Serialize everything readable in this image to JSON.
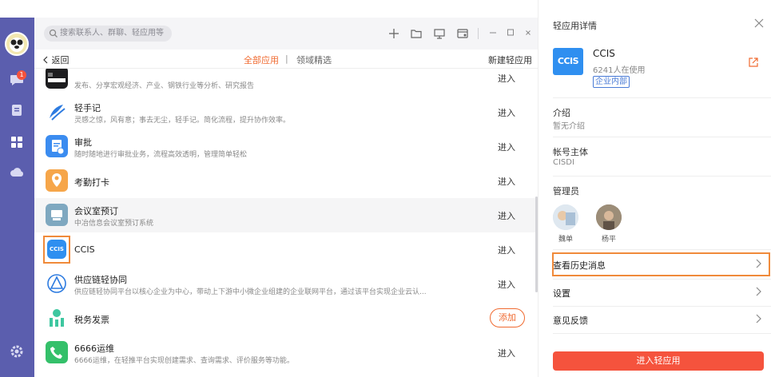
{
  "search": {
    "placeholder": "搜索联系人、群聊、轻应用等"
  },
  "nav": {
    "back": "返回",
    "tab_all": "全部应用",
    "tab_sep": "|",
    "tab_field": "领域精选",
    "new_app": "新建轻应用",
    "chat_badge": "1"
  },
  "apps": [
    {
      "name": "",
      "desc": "发布、分享宏观经济、产业、钢铁行业等分析、研究报告",
      "action": "进入"
    },
    {
      "name": "轻手记",
      "desc": "灵感之惊，风有意；事去无尘，轻手记。简化流程，提升协作效率。",
      "action": "进入"
    },
    {
      "name": "审批",
      "desc": "随时随地进行审批业务，流程高效透明，管理简单轻松",
      "action": "进入"
    },
    {
      "name": "考勤打卡",
      "desc": "",
      "action": "进入"
    },
    {
      "name": "会议室预订",
      "desc": "中冶信息会议室预订系统",
      "action": "进入"
    },
    {
      "name": "CCIS",
      "desc": "",
      "action": "进入"
    },
    {
      "name": "供应链轻协同",
      "desc": "供应链轻协同平台以核心企业为中心，带动上下游中小微企业组建的企业联网平台，通过该平台实现企业云认...",
      "action": "进入"
    },
    {
      "name": "税务发票",
      "desc": "",
      "action": "添加"
    },
    {
      "name": "6666运维",
      "desc": "6666运维，在轻推平台实现创建需求、查询需求、评价服务等功能。",
      "action": "进入"
    }
  ],
  "detail": {
    "title": "轻应用详情",
    "app_name": "CCIS",
    "logo_text": "CCIS",
    "users": "6241人在使用",
    "tag": "企业内部",
    "intro_label": "介绍",
    "intro_value": "暂无介绍",
    "account_label": "帐号主体",
    "account_value": "CISDI",
    "admin_label": "管理员",
    "admins": [
      {
        "name": "魏单"
      },
      {
        "name": "杨平"
      }
    ],
    "history": "查看历史消息",
    "settings": "设置",
    "feedback": "意见反馈",
    "enter_btn": "进入轻应用"
  },
  "colors": {
    "accent": "#f06a30",
    "rail": "#5b5eae",
    "primary_btn": "#f5533d",
    "ccis_blue": "#2f8ff0"
  }
}
